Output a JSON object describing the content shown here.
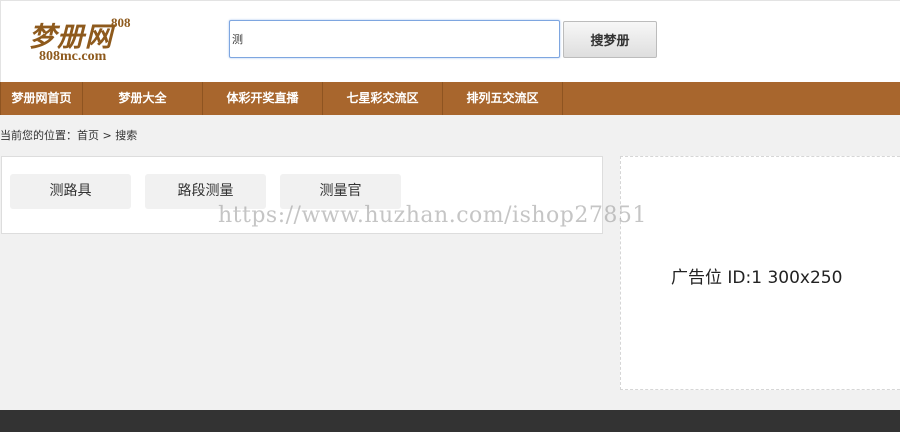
{
  "logo": {
    "main": "梦册网",
    "sup": "808",
    "sub": "808mc.com"
  },
  "search": {
    "value": "测",
    "button_label": "搜梦册"
  },
  "nav": {
    "items": [
      {
        "label": "梦册网首页"
      },
      {
        "label": "梦册大全"
      },
      {
        "label": "体彩开奖直播"
      },
      {
        "label": "七星彩交流区"
      },
      {
        "label": "排列五交流区"
      }
    ]
  },
  "breadcrumb": {
    "prefix": "当前您的位置：",
    "home": "首页",
    "separator": " > ",
    "current": "搜索"
  },
  "results": {
    "tags": [
      {
        "label": "测路具"
      },
      {
        "label": "路段测量"
      },
      {
        "label": "测量官"
      }
    ]
  },
  "ad": {
    "text": "广告位 ID:1 300x250"
  },
  "watermark": "https://www.huzhan.com/ishop27851",
  "colors": {
    "nav_bg": "#a8662d",
    "logo": "#8e5a1d",
    "footer": "#333333",
    "page_bg": "#f1f1f1"
  }
}
